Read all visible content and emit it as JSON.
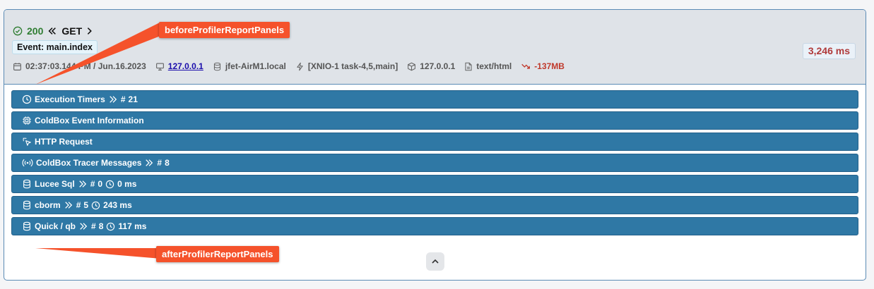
{
  "header": {
    "status_code": "200",
    "method": "GET",
    "event": "Event: main.index",
    "timestamp": "02:37:03.144 PM / Jun.16.2023",
    "ip_link": "127.0.0.1",
    "host": "jfet-AirM1.local",
    "thread": "[XNIO-1 task-4,5,main]",
    "server_ip": "127.0.0.1",
    "content_type": "text/html",
    "memory": "-137MB",
    "duration": "3,246 ms"
  },
  "panels": [
    {
      "title": "Execution Timers",
      "count": "21",
      "icon": "clock-icon"
    },
    {
      "title": "ColdBox Event Information",
      "icon": "cpu-chip-icon"
    },
    {
      "title": "HTTP Request",
      "icon": "cursor-click-icon"
    },
    {
      "title": "ColdBox Tracer Messages",
      "count": "8",
      "icon": "broadcast-icon"
    },
    {
      "title": "Lucee Sql",
      "count": "0",
      "time": "0 ms",
      "icon": "database-icon"
    },
    {
      "title": "cborm",
      "count": "5",
      "time": "243 ms",
      "icon": "database-icon"
    },
    {
      "title": "Quick / qb",
      "count": "8",
      "time": "117 ms",
      "icon": "database-icon"
    }
  ],
  "symbols": {
    "hash": "#",
    "chevrons": "»"
  },
  "callouts": {
    "before": "beforeProfilerReportPanels",
    "after": "afterProfilerReportPanels"
  },
  "colors": {
    "panel_bg": "#2f78a5",
    "callout_bg": "#f5522b",
    "status_ok": "#2f7d32",
    "duration_text": "#b03a3a"
  }
}
